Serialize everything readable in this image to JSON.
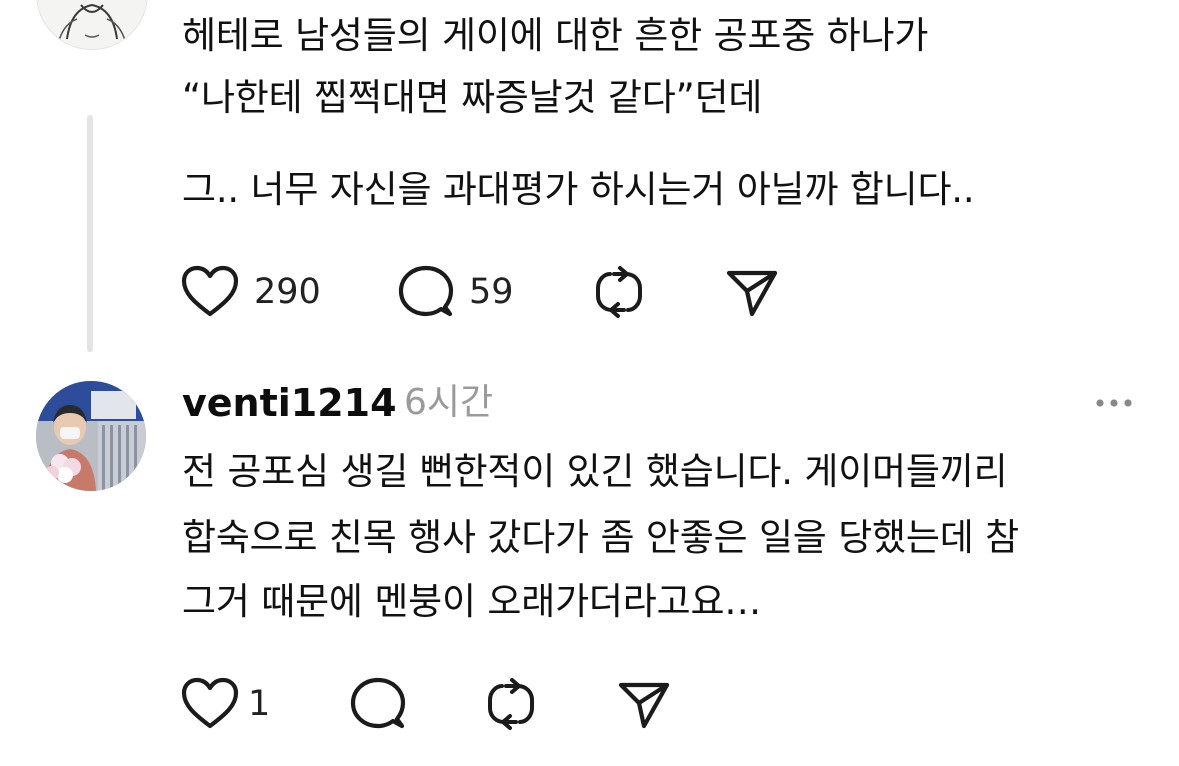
{
  "post1": {
    "lines": [
      "헤테로 남성들의 게이에 대한 흔한 공포중 하나가",
      "“나한테 찝쩍대면 짜증날것 같다”던데",
      "그.. 너무 자신을 과대평가 하시는거 아닐까 합니다.."
    ],
    "likes": "290",
    "replies": "59"
  },
  "post2": {
    "username": "venti1214",
    "time": "6시간",
    "lines": [
      "전 공포심 생길 뻔한적이 있긴 했습니다. 게이머들끼리",
      "합숙으로 친목 행사 갔다가 좀 안좋은 일을 당했는데 참",
      "그거 때문에 멘붕이 오래가더라고요…"
    ],
    "likes": "1"
  },
  "icons": {
    "like": "heart-icon",
    "reply": "speech-bubble-icon",
    "repost": "repost-icon",
    "share": "send-icon",
    "more": "more-horizontal-icon"
  }
}
